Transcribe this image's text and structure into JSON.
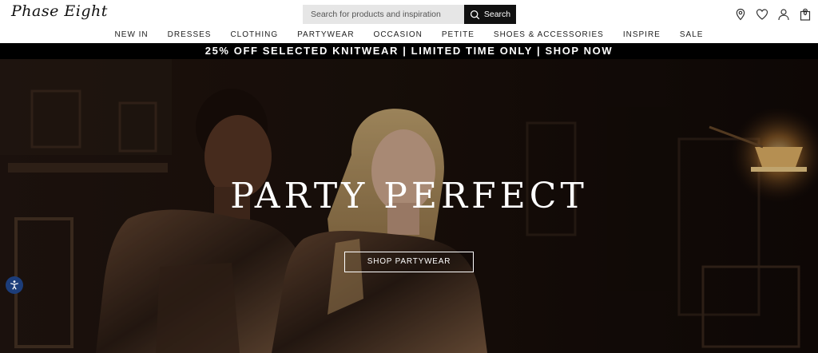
{
  "header": {
    "logo_text": "Phase Eight",
    "search": {
      "placeholder": "Search for products and inspiration",
      "button_label": "Search"
    },
    "icons": [
      "store-locator-icon",
      "wishlist-heart-icon",
      "account-icon",
      "shopping-bag-icon"
    ],
    "bag_count": "0"
  },
  "nav": {
    "items": [
      "NEW IN",
      "DRESSES",
      "CLOTHING",
      "PARTYWEAR",
      "OCCASION",
      "PETITE",
      "SHOES & ACCESSORIES",
      "INSPIRE",
      "SALE"
    ]
  },
  "promo": {
    "text": "25% OFF SELECTED KNITWEAR | LIMITED TIME ONLY | SHOP NOW"
  },
  "hero": {
    "title": "PARTY PERFECT",
    "cta_label": "SHOP PARTYWEAR"
  },
  "colors": {
    "promo_bg": "#000000",
    "search_button_bg": "#111111",
    "search_field_bg": "#e6e6e6",
    "accessibility_button_bg": "#1c3d7a"
  }
}
